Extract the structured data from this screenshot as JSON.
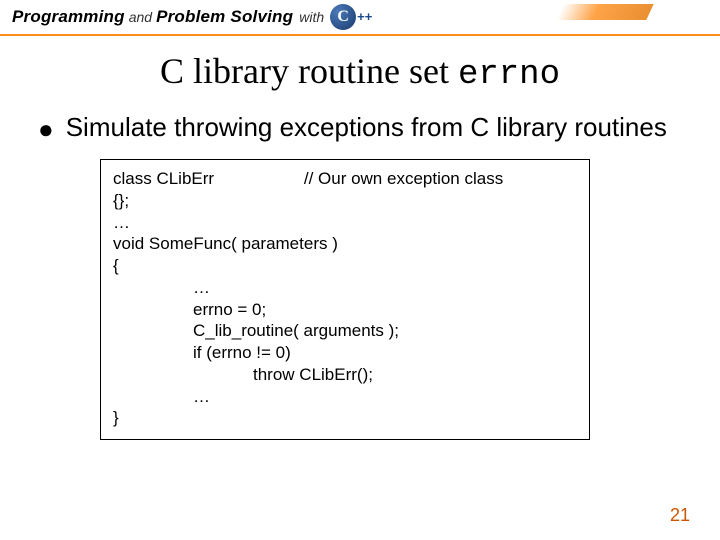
{
  "header": {
    "word1": "Programming",
    "and": "and",
    "word2": "Problem Solving",
    "with": "with",
    "pluses": "++"
  },
  "title": {
    "pre": "C library routine set ",
    "mono": "errno"
  },
  "bullet": {
    "dot": "●",
    "text": "Simulate throwing exceptions from C library routines"
  },
  "code": {
    "l1a": "class CLibErr",
    "l1b": "// Our own exception class",
    "l2": "{};",
    "l3": "…",
    "l4": "void SomeFunc( parameters )",
    "l5": "{",
    "l6": "…",
    "l7": "errno = 0;",
    "l8": "C_lib_routine( arguments );",
    "l9": "if (errno != 0)",
    "l10": "throw CLibErr();",
    "l11": "…",
    "l12": "}"
  },
  "page": "21"
}
